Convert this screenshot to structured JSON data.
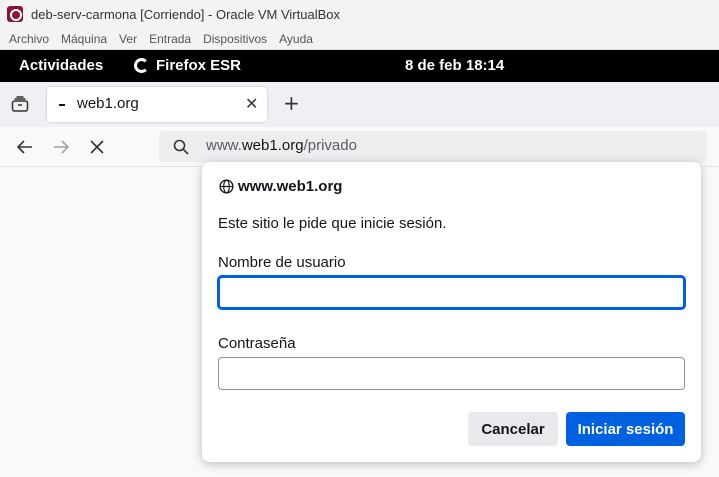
{
  "vbox": {
    "title": "deb-serv-carmona [Corriendo] - Oracle VM VirtualBox",
    "menu": [
      "Archivo",
      "Máquina",
      "Ver",
      "Entrada",
      "Dispositivos",
      "Ayuda"
    ]
  },
  "gnome": {
    "activities": "Actividades",
    "app_name": "Firefox ESR",
    "clock": "8 de feb  18:14"
  },
  "browser": {
    "tab_title": "web1.org",
    "tab_close": "✕",
    "new_tab": "+",
    "url_prefix": "www.",
    "url_host": "web1.org",
    "url_path": "/privado"
  },
  "auth_dialog": {
    "site": "www.web1.org",
    "message": "Este sitio le pide que inicie sesión.",
    "username_label": "Nombre de usuario",
    "username_value": "",
    "password_label": "Contraseña",
    "password_value": "",
    "cancel_label": "Cancelar",
    "submit_label": "Iniciar sesión"
  },
  "colors": {
    "accent": "#0061e0",
    "gnome_bar": "#000000",
    "vbox_icon": "#8a1538"
  }
}
